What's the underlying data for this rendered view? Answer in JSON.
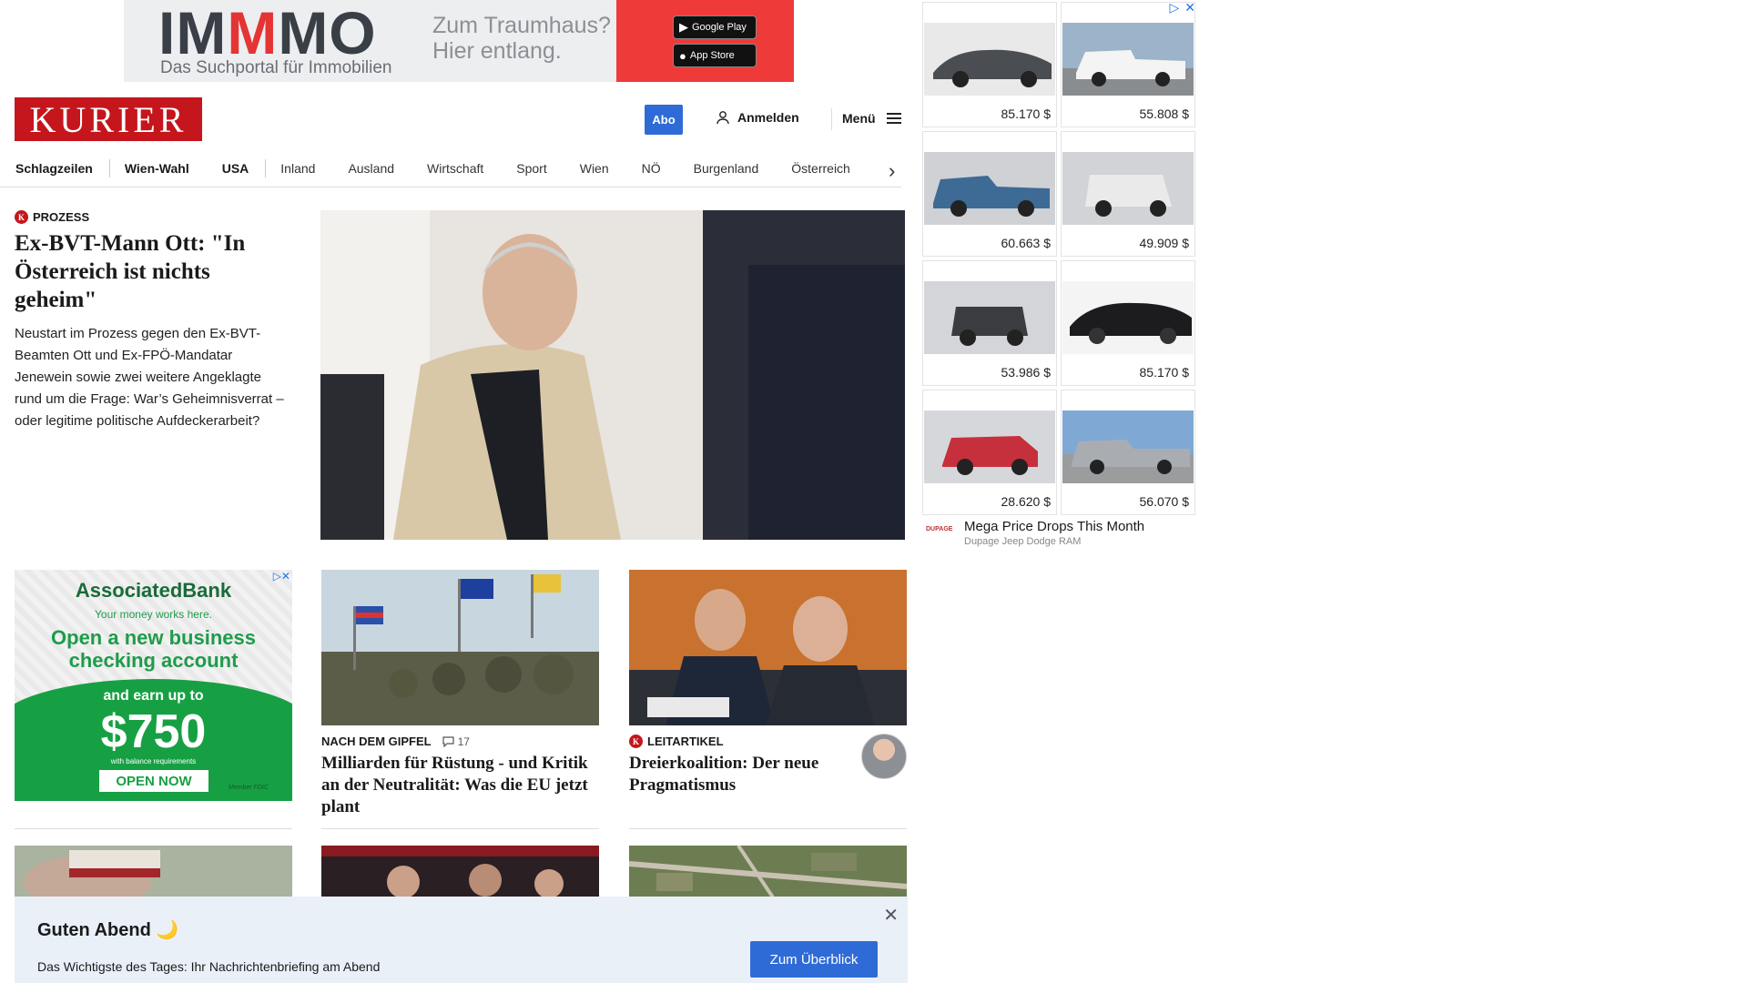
{
  "top_ad": {
    "logo_a": "IM",
    "logo_red": "M",
    "logo_b": "MO",
    "tagline_1": "Zum Traumhaus?",
    "tagline_2": "Hier entlang.",
    "subline": "Das Suchportal für Immobilien",
    "google_play": "Google Play",
    "app_store": "App Store",
    "brand_color": "#ef3a3a"
  },
  "header": {
    "brand": "KURIER",
    "brand_color": "#c4161c",
    "abo": "Abo",
    "login": "Anmelden",
    "menu": "Menü",
    "login_icon": "user-icon",
    "menu_icon": "hamburger-icon"
  },
  "nav": {
    "items": [
      "Schlagzeilen",
      "Wien-Wahl",
      "USA",
      "Inland",
      "Ausland",
      "Wirtschaft",
      "Sport",
      "Wien",
      "NÖ",
      "Burgenland",
      "Österreich"
    ]
  },
  "lead": {
    "kicker": "Prozess",
    "title": "Ex-BVT-Mann Ott: \"In Österreich ist nichts geheim\"",
    "description": "Neustart im Prozess gegen den Ex-BVT-Beamten Ott und Ex-FPÖ-Mandatar Jenewein sowie zwei weitere Angeklagte rund um die Frage: War’s Geheimnisverrat – oder legitime politische Aufdeckerarbeit?"
  },
  "side_ad": {
    "prices": [
      "85.170 $",
      "55.808 $",
      "60.663 $",
      "49.909 $",
      "53.986 $",
      "85.170 $",
      "28.620 $",
      "56.070 $"
    ],
    "footer_title": "Mega Price Drops This Month",
    "footer_sub": "Dupage Jeep Dodge RAM",
    "footer_logo": "DUPAGE"
  },
  "bank_ad": {
    "logo": "AssociatedBank",
    "slogan": "Your money works here.",
    "headline": "Open a new business checking account",
    "earn": "and earn up to",
    "amount": "$750",
    "requirements": "with balance requirements",
    "cta": "OPEN NOW",
    "member": "Member FDIC"
  },
  "cards": [
    {
      "kicker": "Nach dem Gipfel",
      "comments": "17",
      "title": "Milliarden für Rüstung - und Kritik an der Neutralität: Was die EU jetzt plant"
    },
    {
      "kicker": "Leitartikel",
      "title": "Dreierkoalition: Der neue Pragmatismus"
    }
  ],
  "briefing": {
    "title": "Guten Abend 🌙",
    "text": "Das Wichtigste des Tages: Ihr Nachrichtenbriefing am Abend",
    "cta": "Zum Überblick"
  }
}
